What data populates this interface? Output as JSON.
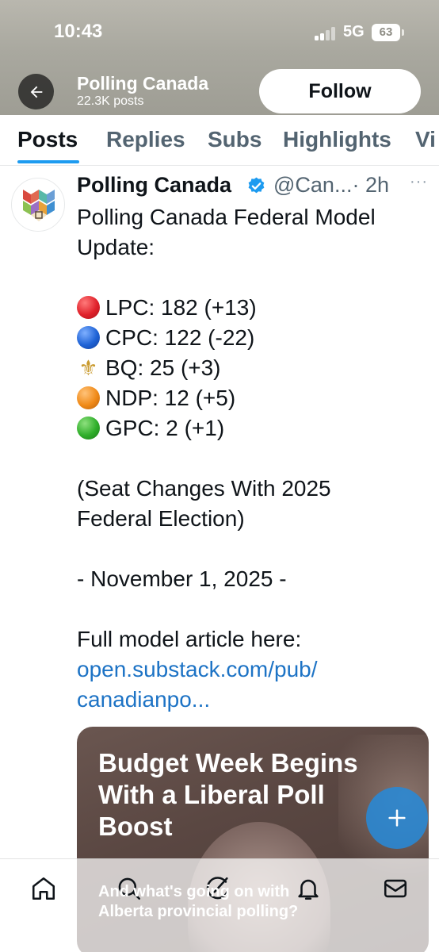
{
  "status_bar": {
    "time": "10:43",
    "network": "5G",
    "battery": "63"
  },
  "header": {
    "title": "Polling Canada",
    "subtitle": "22.3K posts",
    "follow_label": "Follow"
  },
  "tabs": [
    {
      "label": "Posts"
    },
    {
      "label": "Replies"
    },
    {
      "label": "Subs"
    },
    {
      "label": "Highlights"
    },
    {
      "label": "Vi"
    }
  ],
  "post": {
    "author": "Polling Canada",
    "handle": "@Can...",
    "time": "· 2h",
    "more": "···",
    "lines": {
      "l1": "Polling Canada Federal Model",
      "l2": "Update:",
      "lpc": "LPC: 182 (+13)",
      "cpc": "CPC: 122 (-22)",
      "bq": "BQ: 25 (+3)",
      "ndp": "NDP: 12 (+5)",
      "gpc": "GPC: 2 (+1)",
      "note1": "(Seat Changes With 2025",
      "note2": "Federal Election)",
      "date": "- November 1, 2025 -",
      "article": "Full model article here:",
      "link1": "open.substack.com/pub/",
      "link2": "canadianpo..."
    },
    "party_colors": {
      "lpc": "#e0212b",
      "cpc": "#1f63d6",
      "bq": "#c99a2e",
      "ndp": "#f08a18",
      "gpc": "#2fae2a"
    },
    "card": {
      "title": "Budget Week Begins With a Liberal Poll Boost",
      "subtitle": "And what's going on with Alberta provincial polling?"
    }
  },
  "bottom_nav": {
    "items": [
      "home-icon",
      "search-icon",
      "grok-icon",
      "notifications-icon",
      "messages-icon"
    ]
  }
}
